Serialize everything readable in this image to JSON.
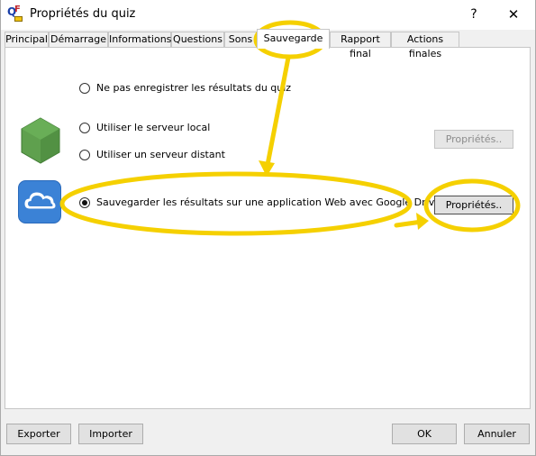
{
  "window": {
    "title": "Propriétés du quiz",
    "help_label": "?",
    "close_label": "✕",
    "icon_letters": {
      "q": "Q",
      "f": "F"
    }
  },
  "tabs": [
    {
      "label": "Principal"
    },
    {
      "label": "Démarrage"
    },
    {
      "label": "Informations"
    },
    {
      "label": "Questions"
    },
    {
      "label": "Sons"
    },
    {
      "label": "Sauvegarde"
    },
    {
      "label": "Rapport final"
    },
    {
      "label": "Actions finales"
    }
  ],
  "active_tab": "Sauvegarde",
  "options": {
    "no_save": "Ne pas enregistrer les résultats du quiz",
    "local_server": "Utiliser le serveur local",
    "remote_server": "Utiliser un serveur distant",
    "google_drive": "Sauvegarder les résultats sur une application Web avec Google Drive"
  },
  "selected_option": "google_drive",
  "buttons": {
    "server_properties": "Propriétés..",
    "drive_properties": "Propriétés..",
    "export": "Exporter",
    "import": "Importer",
    "ok": "OK",
    "cancel": "Annuler"
  },
  "icons": {
    "node_icon": "nodejs-hexagon-icon",
    "cloud_icon": "cloud-icon"
  },
  "colors": {
    "annotation": "#f5d000",
    "node_green": "#5fa04e",
    "cloud_blue": "#3b82d6"
  }
}
